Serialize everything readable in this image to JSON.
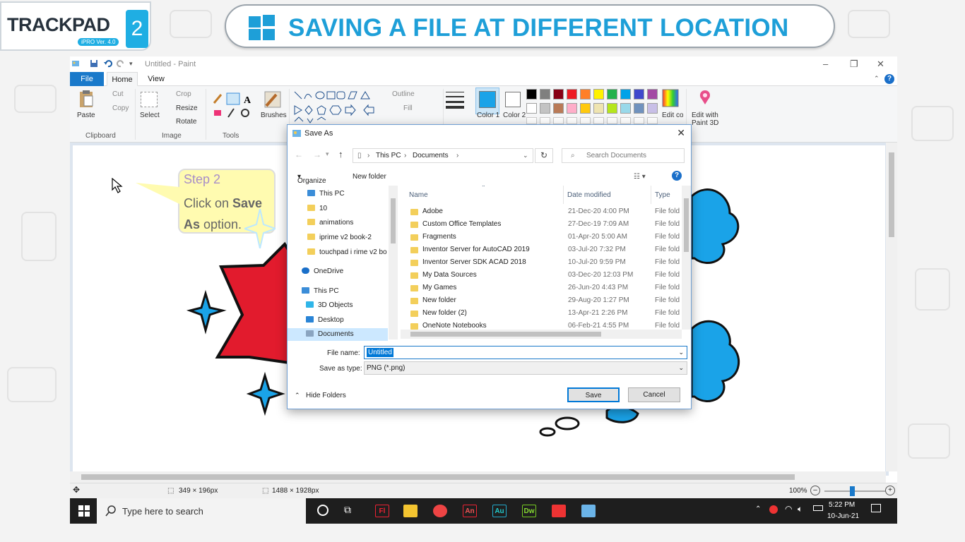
{
  "header": {
    "logo_word": "TRACKPAD",
    "logo_number": "2",
    "logo_version": "iPRO Ver. 4.0",
    "banner_title": "SAVING A FILE AT DIFFERENT LOCATION"
  },
  "paint": {
    "window_title": "Untitled - Paint",
    "tabs": [
      "File",
      "Home",
      "View"
    ],
    "ribbon": {
      "clipboard": {
        "paste": "Paste",
        "cut": "Cut",
        "copy": "Copy",
        "label": "Clipboard"
      },
      "image": {
        "select": "Select",
        "crop": "Crop",
        "resize": "Resize",
        "rotate": "Rotate",
        "label": "Image"
      },
      "tools": {
        "label": "Tools"
      },
      "brushes": "Brushes",
      "shapes": {
        "outline": "Outline",
        "fill": "Fill"
      },
      "size": "Size",
      "color1": "Color 1",
      "color2": "Color 2",
      "edit_colors": "Edit colors",
      "edit_with_paint3d": "Edit with Paint 3D"
    },
    "palette": [
      "#000000",
      "#7f7f7f",
      "#880015",
      "#ed1c24",
      "#ff7f27",
      "#fff200",
      "#22b14c",
      "#00a2e8",
      "#3f48cc",
      "#a349a4",
      "#ffffff",
      "#c3c3c3",
      "#b97a57",
      "#ffaec9",
      "#ffc90e",
      "#efe4b0",
      "#b5e61d",
      "#99d9ea",
      "#7092be",
      "#c8bfe7"
    ],
    "status": {
      "selection_size": "349 × 196px",
      "image_size": "1488 × 1928px",
      "zoom": "100%"
    }
  },
  "callout": {
    "step": "Step 2",
    "msg_prefix": "Click on ",
    "msg_bold": "Save As",
    "msg_suffix": " option."
  },
  "dialog": {
    "title": "Save As",
    "breadcrumb": [
      "This PC",
      "Documents"
    ],
    "search_placeholder": "Search Documents",
    "organize": "Organize",
    "new_folder": "New folder",
    "nav": [
      {
        "label": "This PC",
        "kind": "pc"
      },
      {
        "label": "10",
        "kind": "folder"
      },
      {
        "label": "animations",
        "kind": "folder"
      },
      {
        "label": "iprime v2 book-2",
        "kind": "folder"
      },
      {
        "label": "touchpad i rime v2 bo",
        "kind": "folder"
      },
      {
        "label": "OneDrive",
        "kind": "cloud"
      },
      {
        "label": "This PC",
        "kind": "pc"
      },
      {
        "label": "3D Objects",
        "kind": "cube"
      },
      {
        "label": "Desktop",
        "kind": "desktop"
      },
      {
        "label": "Documents",
        "kind": "doc"
      }
    ],
    "columns": {
      "name": "Name",
      "date": "Date modified",
      "type": "Type"
    },
    "files": [
      {
        "name": "Adobe",
        "date": "21-Dec-20 4:00 PM",
        "type": "File fold"
      },
      {
        "name": "Custom Office Templates",
        "date": "27-Dec-19 7:09 AM",
        "type": "File fold"
      },
      {
        "name": "Fragments",
        "date": "01-Apr-20 5:00 AM",
        "type": "File fold"
      },
      {
        "name": "Inventor Server for AutoCAD 2019",
        "date": "03-Jul-20 7:32 PM",
        "type": "File fold"
      },
      {
        "name": "Inventor Server SDK ACAD 2018",
        "date": "10-Jul-20 9:59 PM",
        "type": "File fold"
      },
      {
        "name": "My Data Sources",
        "date": "03-Dec-20 12:03 PM",
        "type": "File fold"
      },
      {
        "name": "My Games",
        "date": "26-Jun-20 4:43 PM",
        "type": "File fold"
      },
      {
        "name": "New folder",
        "date": "29-Aug-20 1:27 PM",
        "type": "File fold"
      },
      {
        "name": "New folder (2)",
        "date": "13-Apr-21 2:26 PM",
        "type": "File fold"
      },
      {
        "name": "OneNote Notebooks",
        "date": "06-Feb-21 4:55 PM",
        "type": "File fold"
      }
    ],
    "file_name_label": "File name:",
    "file_name_value": "Untitled",
    "save_type_label": "Save as type:",
    "save_type_value": "PNG (*.png)",
    "hide_folders": "Hide Folders",
    "save": "Save",
    "cancel": "Cancel"
  },
  "taskbar": {
    "search_placeholder": "Type here to search",
    "time": "5:22 PM",
    "date": "10-Jun-21",
    "apps": [
      "Fl",
      "An",
      "Au",
      "Dw"
    ]
  }
}
